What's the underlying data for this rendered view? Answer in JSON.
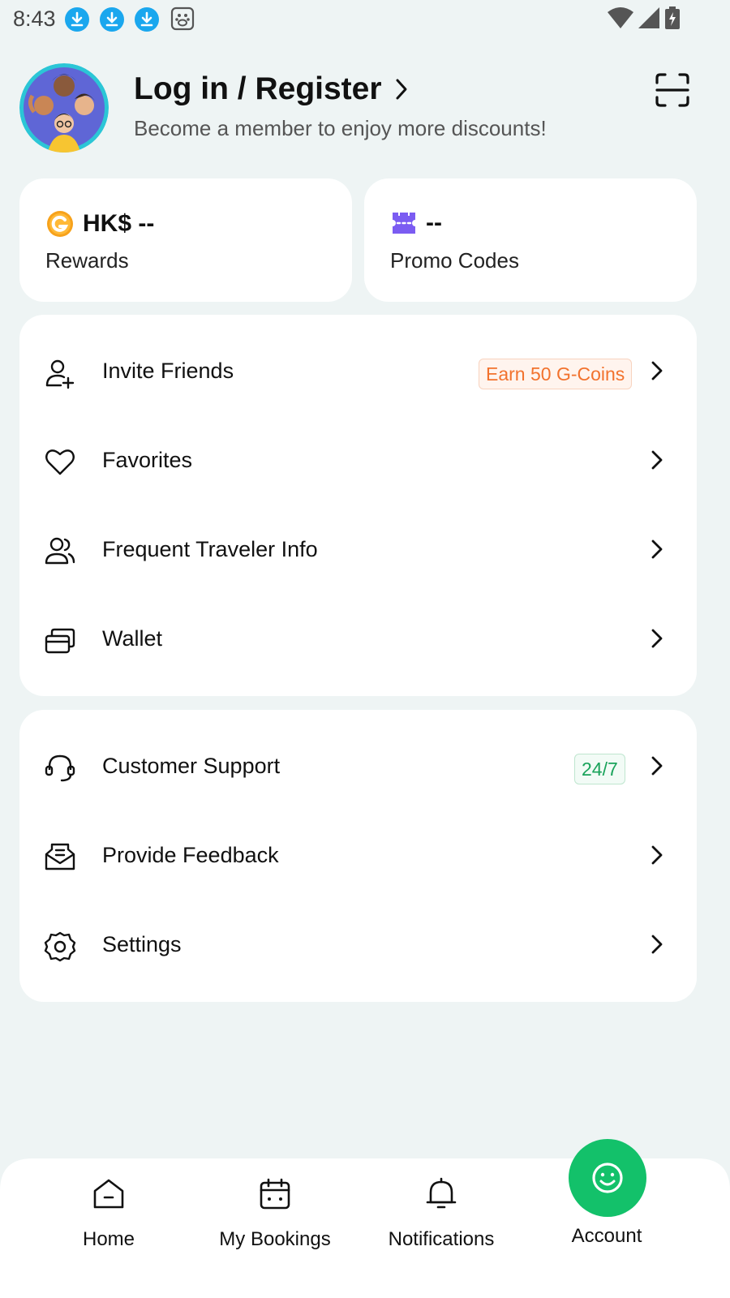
{
  "status_bar": {
    "time": "8:43",
    "notification_icons": [
      "download-icon",
      "download-icon",
      "download-icon",
      "baidu-icon"
    ],
    "system_icons": [
      "wifi-icon",
      "signal-icon",
      "battery-charging-icon"
    ]
  },
  "header": {
    "title": "Log in / Register",
    "subtitle": "Become a member to enjoy more discounts!",
    "avatar_icon": "avatar-illustration",
    "scan_icon": "scan-icon"
  },
  "stats": {
    "rewards": {
      "value": "HK$ --",
      "label": "Rewards",
      "icon": "g-coin-icon",
      "icon_color": "#f7a21b"
    },
    "promo": {
      "value": "--",
      "label": "Promo Codes",
      "icon": "ticket-icon",
      "icon_color": "#7b5cf2"
    }
  },
  "menu_primary": [
    {
      "label": "Invite Friends",
      "icon": "add-user-icon",
      "badge": "Earn 50 G-Coins"
    },
    {
      "label": "Favorites",
      "icon": "heart-icon"
    },
    {
      "label": "Frequent Traveler Info",
      "icon": "travelers-icon"
    },
    {
      "label": "Wallet",
      "icon": "wallet-icon"
    }
  ],
  "menu_secondary": [
    {
      "label": "Customer Support",
      "icon": "headset-icon",
      "badge": "24/7"
    },
    {
      "label": "Provide Feedback",
      "icon": "feedback-icon"
    },
    {
      "label": "Settings",
      "icon": "gear-icon"
    }
  ],
  "bottom_nav": [
    {
      "label": "Home",
      "icon": "home-icon"
    },
    {
      "label": "My Bookings",
      "icon": "calendar-icon"
    },
    {
      "label": "Notifications",
      "icon": "bell-icon"
    },
    {
      "label": "Account",
      "icon": "smile-icon",
      "active": true
    }
  ],
  "colors": {
    "background": "#eef4f4",
    "accent_green": "#13c16a",
    "badge_orange": "#f2722d",
    "badge_green": "#1aa35b"
  }
}
